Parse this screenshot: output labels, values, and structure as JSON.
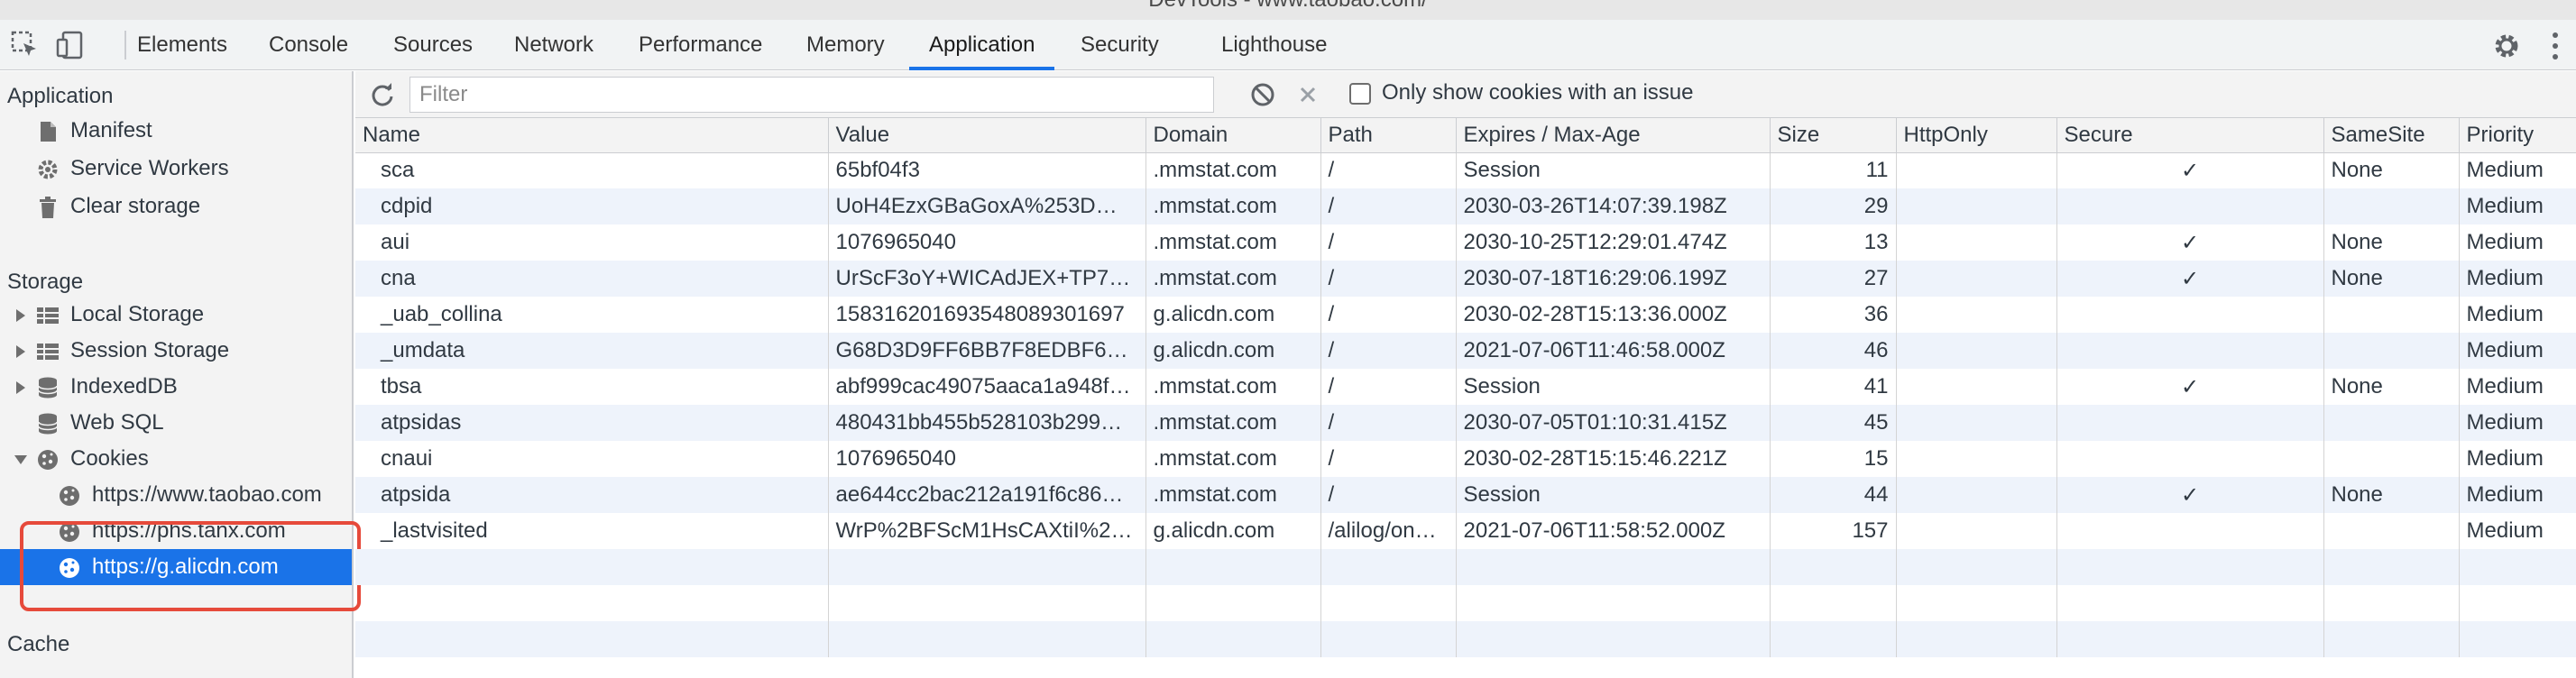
{
  "window": {
    "title": "DevTools - www.taobao.com/"
  },
  "tabs": [
    {
      "label": "Elements"
    },
    {
      "label": "Console"
    },
    {
      "label": "Sources"
    },
    {
      "label": "Network"
    },
    {
      "label": "Performance"
    },
    {
      "label": "Memory"
    },
    {
      "label": "Application"
    },
    {
      "label": "Security"
    },
    {
      "label": "Lighthouse"
    }
  ],
  "sidebar": {
    "application_header": "Application",
    "application_items": [
      {
        "label": "Manifest",
        "icon": "document-icon"
      },
      {
        "label": "Service Workers",
        "icon": "gear-icon"
      },
      {
        "label": "Clear storage",
        "icon": "trash-icon"
      }
    ],
    "storage_header": "Storage",
    "storage_items": [
      {
        "label": "Local Storage",
        "icon": "grid-icon"
      },
      {
        "label": "Session Storage",
        "icon": "grid-icon"
      },
      {
        "label": "IndexedDB",
        "icon": "database-icon"
      },
      {
        "label": "Web SQL",
        "icon": "database-icon"
      },
      {
        "label": "Cookies",
        "icon": "cookie-icon"
      }
    ],
    "cookie_origins": [
      {
        "label": "https://www.taobao.com"
      },
      {
        "label": "https://phs.tanx.com"
      },
      {
        "label": "https://g.alicdn.com"
      }
    ],
    "cache_header": "Cache"
  },
  "toolbar": {
    "filter_placeholder": "Filter",
    "only_issues_label": "Only show cookies with an issue"
  },
  "cookies_table": {
    "columns": [
      "Name",
      "Value",
      "Domain",
      "Path",
      "Expires / Max-Age",
      "Size",
      "HttpOnly",
      "Secure",
      "SameSite",
      "Priority"
    ],
    "rows": [
      [
        "sca",
        "65bf04f3",
        ".mmstat.com",
        "/",
        "Session",
        "11",
        "",
        "✓",
        "None",
        "Medium"
      ],
      [
        "cdpid",
        "UoH4EzxGBaGoxA%253D…",
        ".mmstat.com",
        "/",
        "2030-03-26T14:07:39.198Z",
        "29",
        "",
        "",
        "",
        "Medium"
      ],
      [
        "aui",
        "1076965040",
        ".mmstat.com",
        "/",
        "2030-10-25T12:29:01.474Z",
        "13",
        "",
        "✓",
        "None",
        "Medium"
      ],
      [
        "cna",
        "UrScF3oY+WICAdJEX+TP7…",
        ".mmstat.com",
        "/",
        "2030-07-18T16:29:06.199Z",
        "27",
        "",
        "✓",
        "None",
        "Medium"
      ],
      [
        "_uab_collina",
        "158316201693548089301697",
        "g.alicdn.com",
        "/",
        "2030-02-28T15:13:36.000Z",
        "36",
        "",
        "",
        "",
        "Medium"
      ],
      [
        "_umdata",
        "G68D3D9FF6BB7F8EDBF68…",
        "g.alicdn.com",
        "/",
        "2021-07-06T11:46:58.000Z",
        "46",
        "",
        "",
        "",
        "Medium"
      ],
      [
        "tbsa",
        "abf999cac49075aaca1a948f…",
        ".mmstat.com",
        "/",
        "Session",
        "41",
        "",
        "✓",
        "None",
        "Medium"
      ],
      [
        "atpsidas",
        "480431bb455b528103b299…",
        ".mmstat.com",
        "/",
        "2030-07-05T01:10:31.415Z",
        "45",
        "",
        "",
        "",
        "Medium"
      ],
      [
        "cnaui",
        "1076965040",
        ".mmstat.com",
        "/",
        "2030-02-28T15:15:46.221Z",
        "15",
        "",
        "",
        "",
        "Medium"
      ],
      [
        "atpsida",
        "ae644cc2bac212a191f6c86…",
        ".mmstat.com",
        "/",
        "Session",
        "44",
        "",
        "✓",
        "None",
        "Medium"
      ],
      [
        "_lastvisited",
        "WrP%2BFScM1HsCAXtiI%2…",
        "g.alicdn.com",
        "/alilog/on…",
        "2021-07-06T11:58:52.000Z",
        "157",
        "",
        "",
        "",
        "Medium"
      ]
    ]
  },
  "colors": {
    "accent": "#1a73e8",
    "highlight_box": "#e64a3b"
  }
}
